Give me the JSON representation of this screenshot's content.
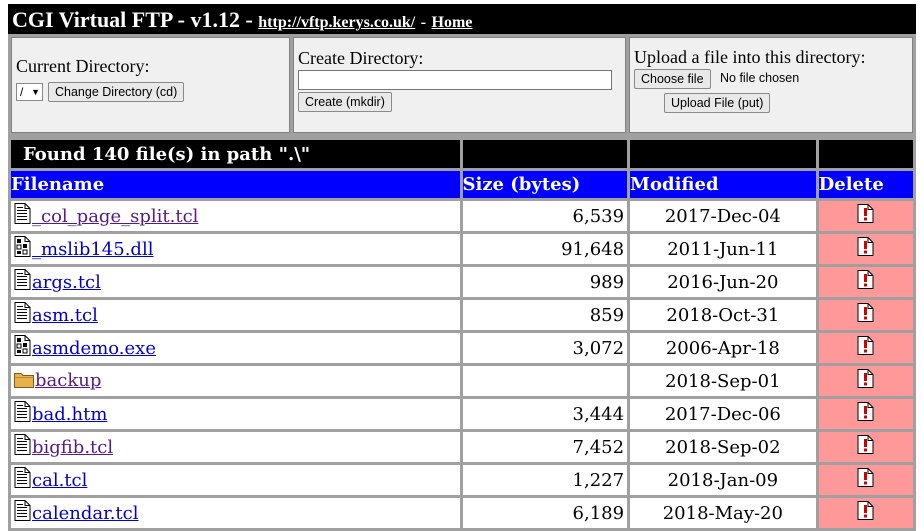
{
  "header": {
    "title": "CGI Virtual FTP - v1.12 -",
    "url_link": "http://vftp.kerys.co.uk/",
    "separator": "-",
    "home_link": "Home"
  },
  "cd_panel": {
    "label": "Current Directory:",
    "dir_value": "/",
    "button": "Change Directory (cd)"
  },
  "mkdir_panel": {
    "label": "Create Directory:",
    "input_value": "",
    "button": "Create (mkdir)"
  },
  "upload_panel": {
    "label": "Upload a file into this directory:",
    "choose_button": "Choose file",
    "no_file_text": "No file chosen",
    "upload_button": "Upload File (put)"
  },
  "listing": {
    "found_text": "Found 140 file(s) in path \".\\\"",
    "columns": {
      "filename": "Filename",
      "size": "Size (bytes)",
      "modified": "Modified",
      "delete": "Delete"
    },
    "delete_color": "#ff9999",
    "header_color": "#0000ff",
    "files": [
      {
        "name": "_col_page_split.tcl",
        "size": "6,539",
        "modified": "2017-Dec-04",
        "icon": "text-file-icon",
        "visited": true
      },
      {
        "name": "_mslib145.dll",
        "size": "91,648",
        "modified": "2011-Jun-11",
        "icon": "binary-file-icon",
        "visited": false
      },
      {
        "name": "args.tcl",
        "size": "989",
        "modified": "2016-Jun-20",
        "icon": "text-file-icon",
        "visited": false
      },
      {
        "name": "asm.tcl",
        "size": "859",
        "modified": "2018-Oct-31",
        "icon": "text-file-icon",
        "visited": false
      },
      {
        "name": "asmdemo.exe",
        "size": "3,072",
        "modified": "2006-Apr-18",
        "icon": "binary-file-icon",
        "visited": false
      },
      {
        "name": "backup",
        "size": "",
        "modified": "2018-Sep-01",
        "icon": "folder-icon",
        "visited": true
      },
      {
        "name": "bad.htm",
        "size": "3,444",
        "modified": "2017-Dec-06",
        "icon": "text-file-icon",
        "visited": false
      },
      {
        "name": "bigfib.tcl",
        "size": "7,452",
        "modified": "2018-Sep-02",
        "icon": "text-file-icon",
        "visited": true
      },
      {
        "name": "cal.tcl",
        "size": "1,227",
        "modified": "2018-Jan-09",
        "icon": "text-file-icon",
        "visited": false
      },
      {
        "name": "calendar.tcl",
        "size": "6,189",
        "modified": "2018-May-20",
        "icon": "text-file-icon",
        "visited": false
      }
    ]
  }
}
